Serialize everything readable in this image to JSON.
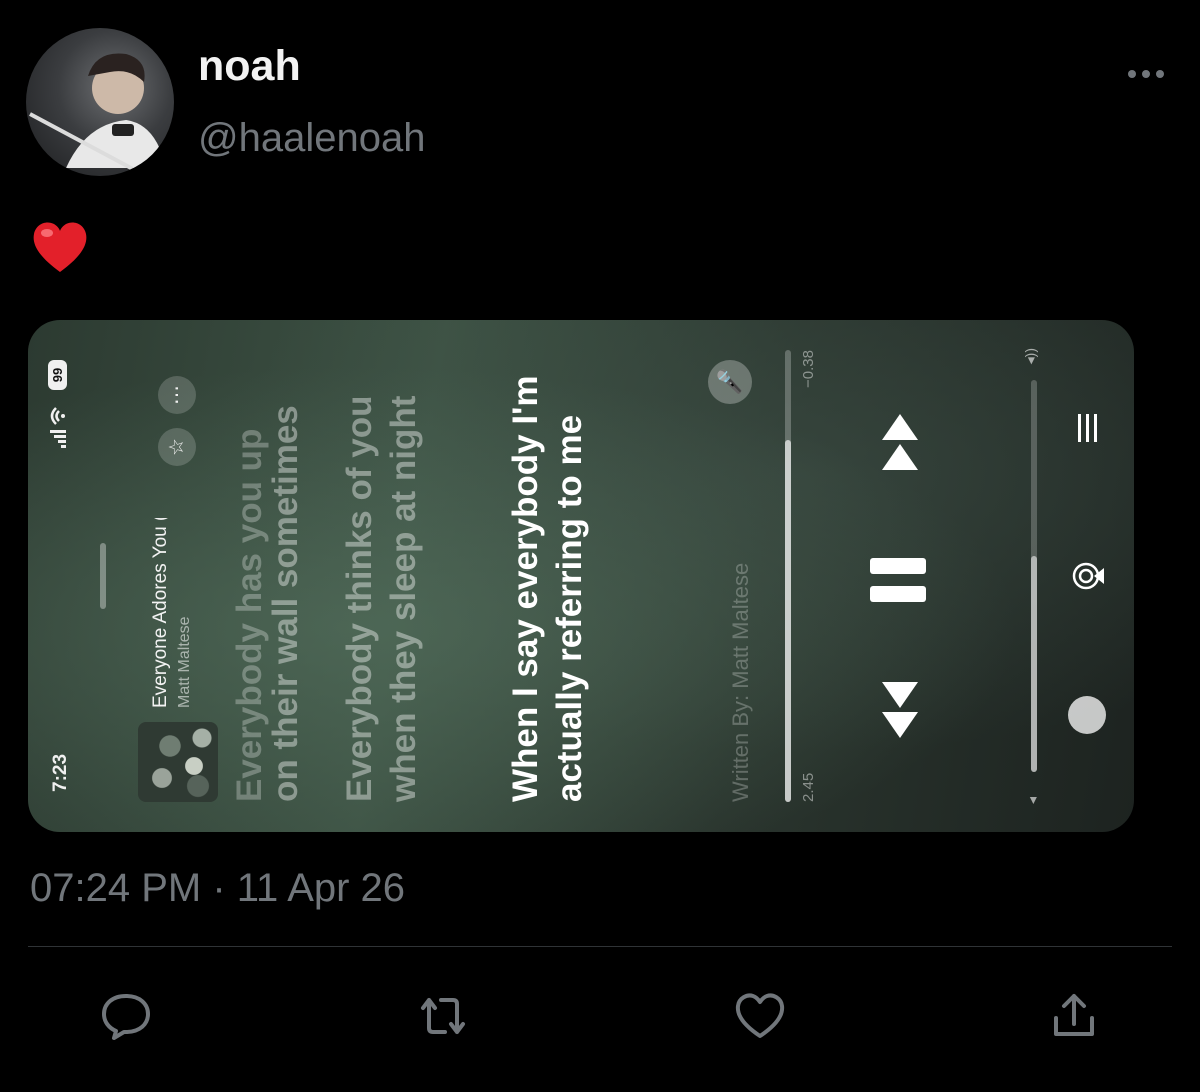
{
  "tweet": {
    "display_name": "noah",
    "handle": "@haalenoah",
    "body_emoji": "❤️",
    "timestamp": "07:24 PM · 11 Apr 26"
  },
  "media": {
    "status_time": "7:23",
    "battery": "99",
    "now_playing": {
      "title": "Everyone Adores You (At L",
      "artist": "Matt Maltese"
    },
    "lyrics": [
      "Everybody has you up",
      "on their wall sometimes",
      "Everybody thinks of you when they sleep at night",
      "When I say everybody I'm actually referring to me"
    ],
    "credit": "Written By: Matt Maltese",
    "elapsed": "2.45",
    "remaining": "−0.38",
    "progress_fraction": 0.8,
    "volume_fraction": 0.55
  },
  "icons": {
    "more": "more-horizontal-icon",
    "reply": "reply-icon",
    "retweet": "retweet-icon",
    "like": "like-icon",
    "share": "share-icon"
  },
  "colors": {
    "background": "#000000",
    "text_primary": "#e7e9ea",
    "text_secondary": "#71767b",
    "divider": "#2f3336"
  }
}
